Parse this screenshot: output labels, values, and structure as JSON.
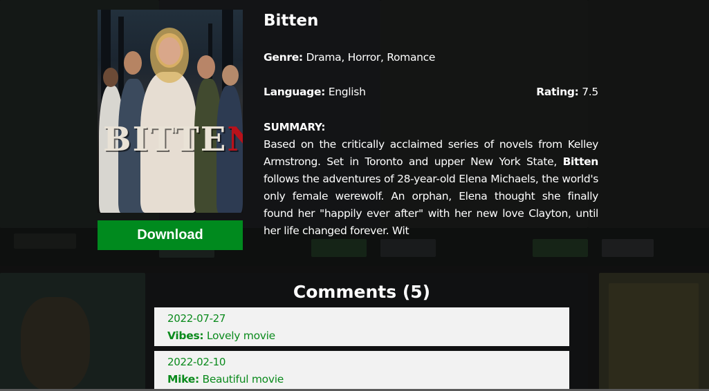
{
  "movie": {
    "title": "Bitten",
    "poster_text_main": "BITTE",
    "poster_text_accent": "N",
    "genre_label": "Genre:",
    "genre": "Drama, Horror, Romance",
    "language_label": "Language:",
    "language": "English",
    "rating_label": "Rating:",
    "rating": "7.5",
    "summary_label": "SUMMARY:",
    "summary_before": "Based on the critically acclaimed series of novels from Kelley Armstrong. Set in Toronto and upper New York State, ",
    "summary_bold": "Bitten",
    "summary_after": " follows the adventures of 28-year-old Elena Michaels, the world's only female werewolf. An orphan, Elena thought she finally found her \"happily ever after\" with her new love Clayton, until her life changed forever. Wit"
  },
  "actions": {
    "download_label": "Download"
  },
  "comments": {
    "heading": "Comments (5)",
    "items": [
      {
        "date": "2022-07-27",
        "author": "Vibes:",
        "text": "Lovely movie"
      },
      {
        "date": "2022-02-10",
        "author": "Mike:",
        "text": "Beautiful movie"
      }
    ]
  },
  "colors": {
    "accent_green": "#008a1e",
    "comment_green": "#0a8a1c",
    "background": "#141414"
  }
}
